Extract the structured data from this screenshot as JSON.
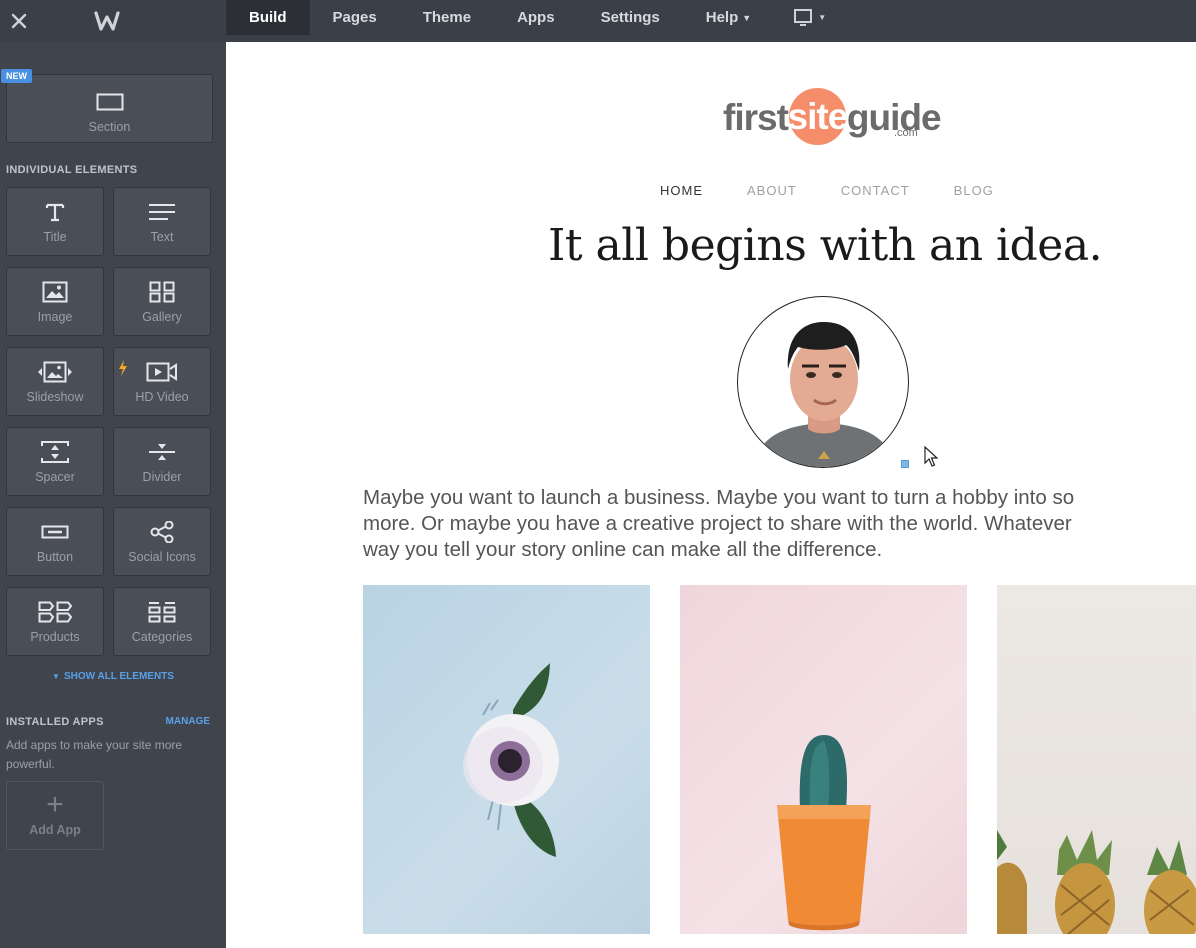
{
  "topbar": {
    "tabs": [
      {
        "label": "Build"
      },
      {
        "label": "Pages"
      },
      {
        "label": "Theme"
      },
      {
        "label": "Apps"
      },
      {
        "label": "Settings"
      },
      {
        "label": "Help"
      }
    ]
  },
  "sidebar": {
    "new_badge": "NEW",
    "section_label": "Section",
    "individual_heading": "INDIVIDUAL ELEMENTS",
    "elements": [
      {
        "label": "Title",
        "icon": "title-icon"
      },
      {
        "label": "Text",
        "icon": "text-icon"
      },
      {
        "label": "Image",
        "icon": "image-icon"
      },
      {
        "label": "Gallery",
        "icon": "gallery-icon"
      },
      {
        "label": "Slideshow",
        "icon": "slideshow-icon"
      },
      {
        "label": "HD Video",
        "icon": "video-icon"
      },
      {
        "label": "Spacer",
        "icon": "spacer-icon"
      },
      {
        "label": "Divider",
        "icon": "divider-icon"
      },
      {
        "label": "Button",
        "icon": "button-icon"
      },
      {
        "label": "Social Icons",
        "icon": "share-icon"
      },
      {
        "label": "Products",
        "icon": "products-icon"
      },
      {
        "label": "Categories",
        "icon": "categories-icon"
      }
    ],
    "show_all": "SHOW ALL ELEMENTS",
    "installed_heading": "INSTALLED APPS",
    "manage": "MANAGE",
    "apps_desc": "Add apps to make your site more powerful.",
    "add_app": "Add App"
  },
  "site": {
    "logo_first": "first",
    "logo_site": "site",
    "logo_guide": "guide",
    "logo_com": ".com",
    "nav": [
      "HOME",
      "ABOUT",
      "CONTACT",
      "BLOG"
    ],
    "headline": "It all begins with an idea.",
    "paragraph_lines": [
      "Maybe you want to launch a business. Maybe you want to turn a hobby into so",
      "more. Or maybe you have a creative project to share with the world. Whatever",
      "way you tell your story online can make all the difference."
    ]
  },
  "colors": {
    "topbar_bg": "#3b4048",
    "sidebar_bg": "#40454d",
    "accent_blue": "#4a90e2",
    "logo_orange": "#f58d6b"
  }
}
